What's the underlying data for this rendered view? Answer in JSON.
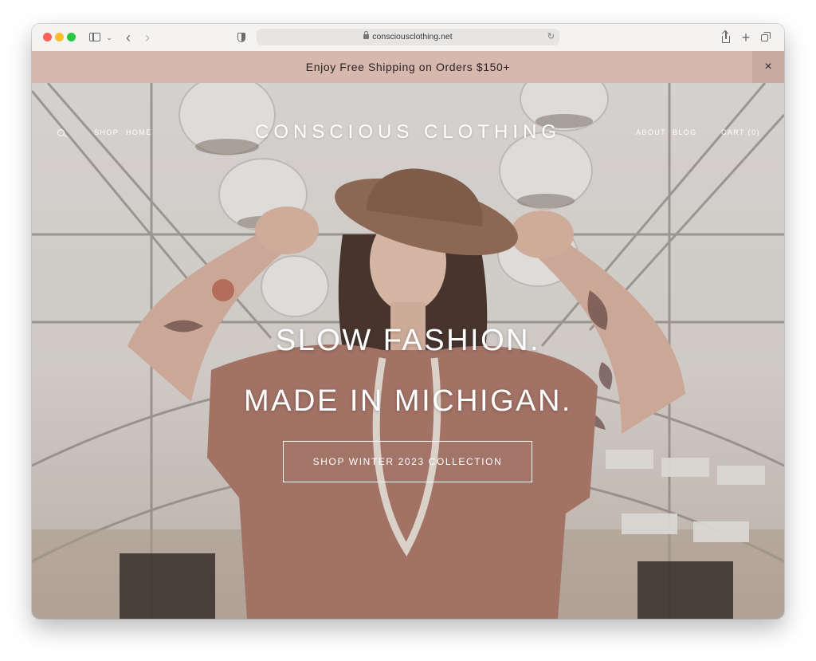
{
  "browser": {
    "url": "consciousclothing.net",
    "icons": [
      "sidebar-toggle-icon",
      "chevron-down-icon",
      "back-arrow-icon",
      "forward-arrow-icon",
      "privacy-shield-icon",
      "lock-icon",
      "reload-icon",
      "share-icon",
      "plus-icon",
      "tabs-overview-icon"
    ]
  },
  "announcement": {
    "text": "Enjoy Free Shipping on Orders $150+",
    "close_label": "×",
    "background": "#d6b8ae"
  },
  "nav": {
    "search_icon": "search-icon",
    "left": [
      "SHOP",
      "HOME"
    ],
    "right": [
      "ABOUT",
      "BLOG"
    ],
    "cart": "CART (0)"
  },
  "brand": {
    "name": "CONSCIOUS CLOTHING"
  },
  "hero": {
    "line1": "SLOW FASHION.",
    "line2": "MADE IN MICHIGAN.",
    "cta": "SHOP WINTER 2023 COLLECTION"
  }
}
